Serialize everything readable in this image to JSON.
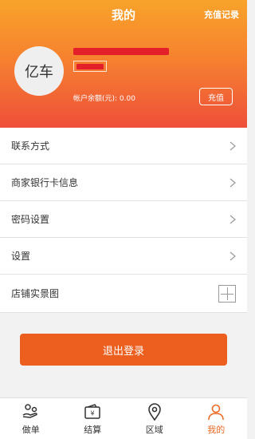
{
  "header": {
    "title": "我的",
    "recharge_record": "充值记录",
    "avatar_text": "亿车",
    "balance_text": "帐户余额(元): 0.00",
    "recharge_button": "充值"
  },
  "menu": {
    "items": [
      {
        "label": "联系方式"
      },
      {
        "label": "商家银行卡信息"
      },
      {
        "label": "密码设置"
      },
      {
        "label": "设置"
      }
    ],
    "store_photos": "店铺实景图"
  },
  "logout_label": "退出登录",
  "bottom_nav": {
    "items": [
      {
        "label": "做单",
        "icon": "order-icon"
      },
      {
        "label": "结算",
        "icon": "wallet-icon"
      },
      {
        "label": "区域",
        "icon": "location-pin-icon"
      },
      {
        "label": "我的",
        "icon": "person-icon"
      }
    ],
    "active_index": 3
  },
  "colors": {
    "accent": "#ed5f1f",
    "header_top": "#f9a32a",
    "header_bottom": "#ee4f3a",
    "active_nav": "#ec6a25"
  }
}
